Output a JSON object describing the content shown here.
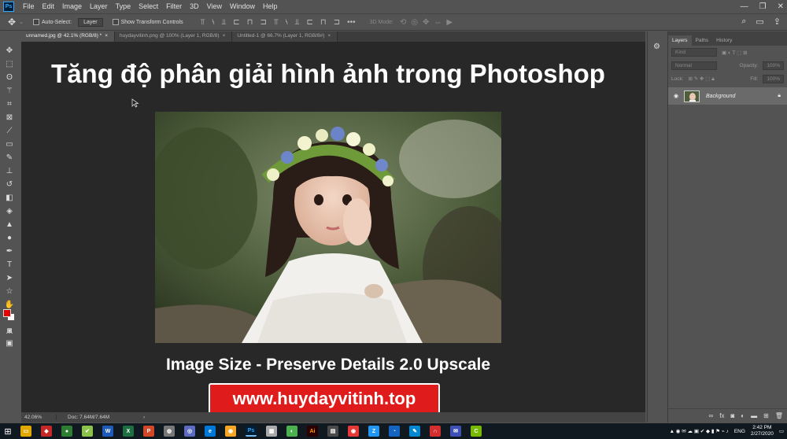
{
  "menubar": {
    "logo": "Ps",
    "items": [
      "File",
      "Edit",
      "Image",
      "Layer",
      "Type",
      "Select",
      "Filter",
      "3D",
      "View",
      "Window",
      "Help"
    ],
    "controls": {
      "minimize": "—",
      "restore": "❐",
      "close": "✕"
    }
  },
  "options": {
    "auto_select_label": "Auto-Select:",
    "auto_select_value": "Layer",
    "show_transform_label": "Show Transform Controls",
    "threed_mode_label": "3D Mode:",
    "more": "•••"
  },
  "tabs": [
    {
      "label": "unnamed.jpg @ 42.1% (RGB/8) *",
      "close": "×"
    },
    {
      "label": "huydayvitinh.png @ 100% (Layer 1, RGB/8)",
      "close": "×"
    },
    {
      "label": "Untitled-1 @ 66.7% (Layer 1, RGB/8#)",
      "close": "×"
    }
  ],
  "canvas": {
    "title": "Tăng độ phân giải hình ảnh trong Photoshop",
    "caption": "Image Size - Preserve Details 2.0 Upscale",
    "url": "www.huydayvitinh.top"
  },
  "status": {
    "zoom": "42.06%",
    "doc": "Doc: 7.64M/7.64M",
    "arrow": "›"
  },
  "panel": {
    "tabs": [
      "Layers",
      "Paths",
      "History"
    ],
    "kind_placeholder": "Kind",
    "blend_mode": "Normal",
    "opacity_label": "Opacity:",
    "opacity_value": "100%",
    "lock_label": "Lock:",
    "fill_label": "Fill:",
    "fill_value": "100%",
    "layer_name": "Background"
  },
  "taskbar": {
    "lang": "ENG",
    "time": "2:42 PM",
    "date": "2/27/2020"
  },
  "colors": {
    "foreground": "#e60000",
    "background": "#ffffff",
    "url_box": "#e01b1b"
  }
}
